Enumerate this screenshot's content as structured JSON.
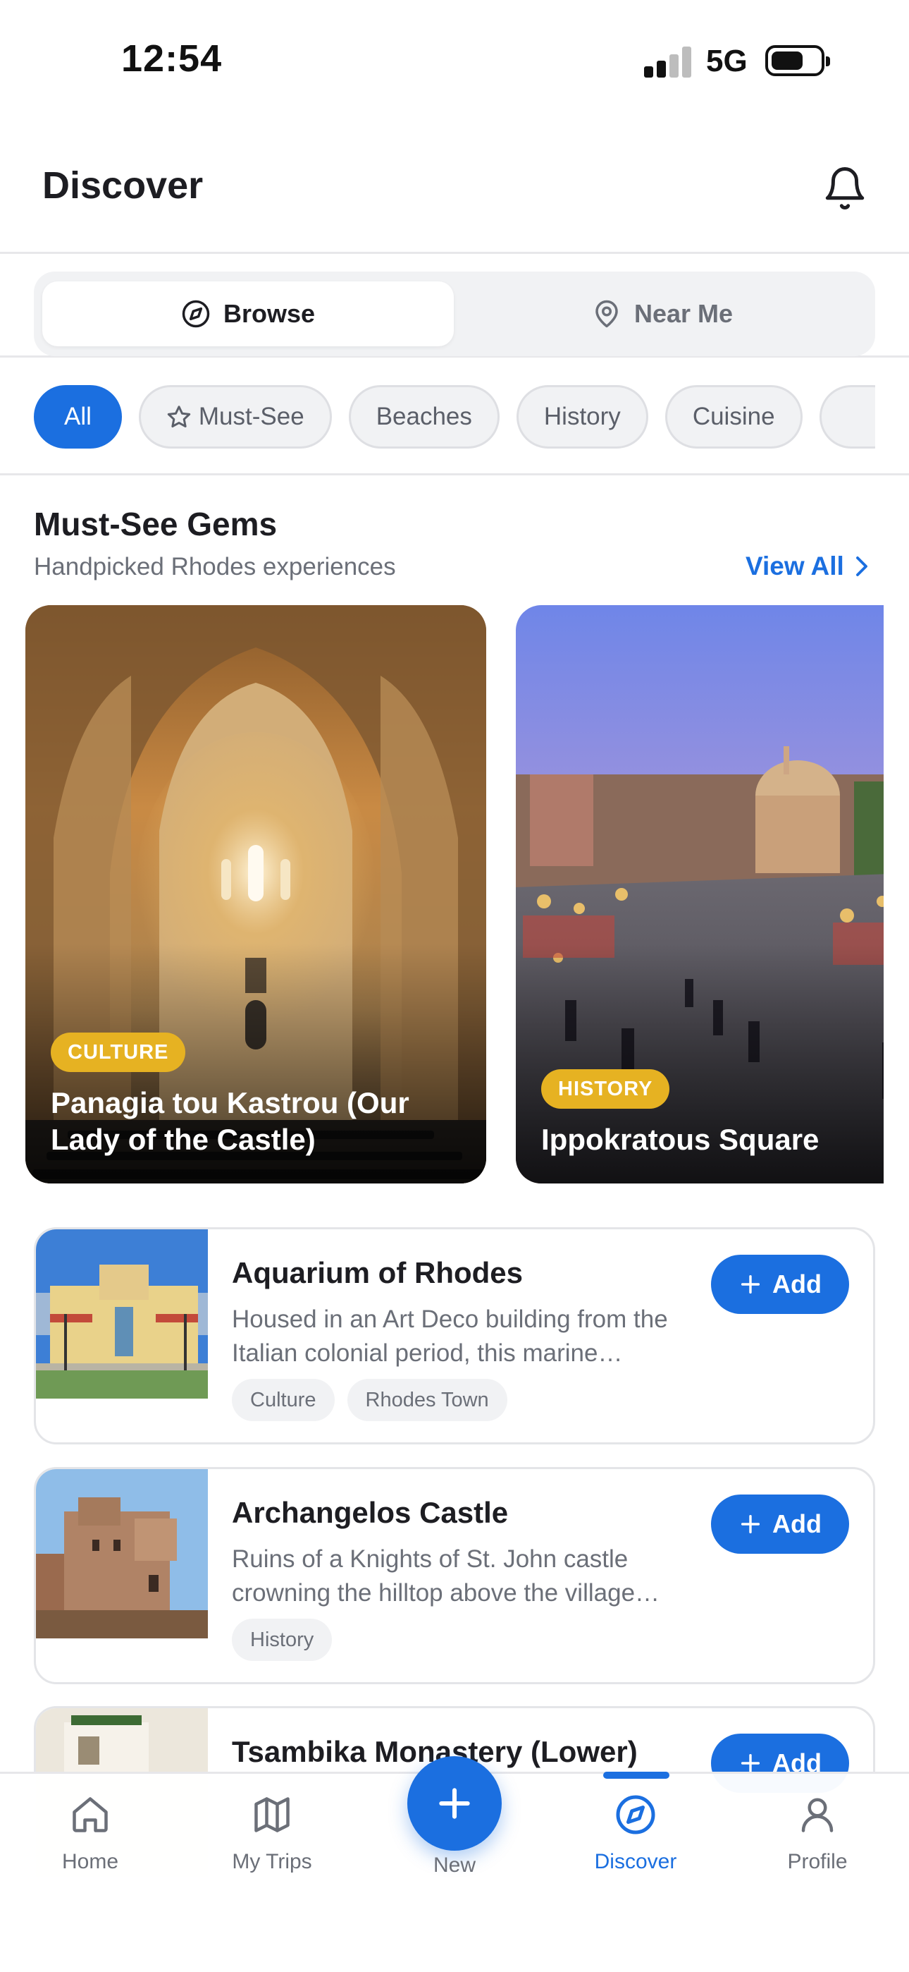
{
  "status_bar": {
    "time": "12:54",
    "network": "5G"
  },
  "header": {
    "title": "Discover"
  },
  "segmented": {
    "browse": "Browse",
    "near_me": "Near Me"
  },
  "chips": {
    "all": "All",
    "must_see": "Must-See",
    "beaches": "Beaches",
    "history": "History",
    "cuisine": "Cuisine"
  },
  "section": {
    "title": "Must-See Gems",
    "subtitle": "Handpicked Rhodes experiences",
    "view_all": "View All"
  },
  "featured": [
    {
      "badge": "CULTURE",
      "title": "Panagia tou Kastrou (Our Lady of the Castle)"
    },
    {
      "badge": "HISTORY",
      "title": "Ippokratous Square"
    }
  ],
  "list": [
    {
      "title": "Aquarium of Rhodes",
      "description": "Housed in an Art Deco building from the Italian colonial period, this marine…",
      "tags": [
        "Culture",
        "Rhodes Town"
      ],
      "add_label": "Add"
    },
    {
      "title": "Archangelos Castle",
      "description": "Ruins of a Knights of St. John castle crowning the hilltop above the village…",
      "tags": [
        "History"
      ],
      "add_label": "Add"
    },
    {
      "title": "Tsambika Monastery (Lower)",
      "add_label": "Add"
    }
  ],
  "tabbar": {
    "home": "Home",
    "trips": "My Trips",
    "new": "New",
    "discover": "Discover",
    "profile": "Profile"
  },
  "colors": {
    "accent": "#1b6fe0",
    "badge": "#e6b222"
  }
}
